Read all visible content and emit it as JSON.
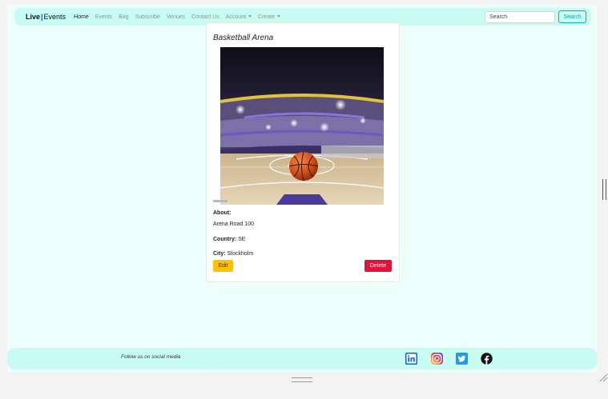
{
  "nav": {
    "brand_bold": "Live",
    "brand_sep": "|",
    "brand_rest": "Events",
    "links": [
      "Home",
      "Events",
      "Bag",
      "Subscribe",
      "Venues",
      "Contact Us",
      "Account",
      "Create"
    ],
    "search_placeholder": "Search",
    "search_button": "Search"
  },
  "venue": {
    "title": "Basketball Arena",
    "about_label": "About:",
    "address": "Arena Road 100",
    "country_label": "Country:",
    "country": "SE",
    "city_label": "City:",
    "city": "Stockholm"
  },
  "buttons": {
    "edit": "Edit",
    "delete": "Delete"
  },
  "footer": {
    "follow_text": "Follow us on social media",
    "icons": [
      "linkedin-icon",
      "instagram-icon",
      "twitter-icon",
      "facebook-icon"
    ]
  },
  "colors": {
    "page_bg": "#ecfffa",
    "navbar_bg": "#c8fbf1",
    "brand_accent": "#0b4ad8",
    "edit": "#ffc107",
    "delete": "#dc143c",
    "search_outline": "#17a2b8"
  }
}
